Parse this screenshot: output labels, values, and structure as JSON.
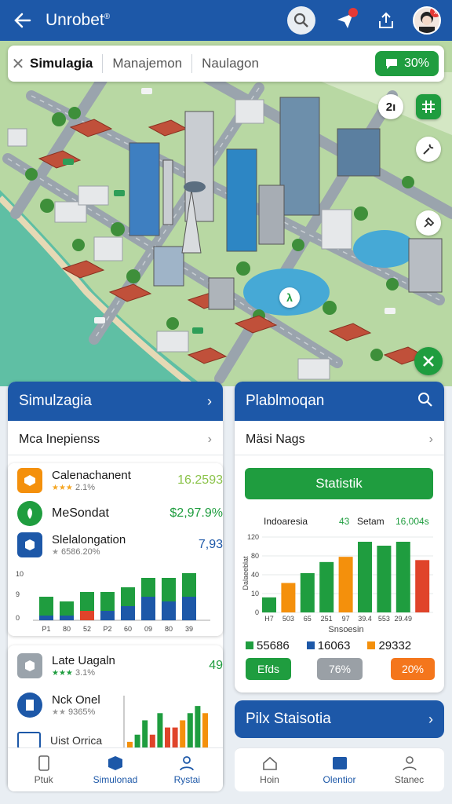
{
  "app": {
    "title": "Unrobet",
    "trademark": "®"
  },
  "header": {
    "avatar_badge": "x"
  },
  "tabs": {
    "items": [
      "Simulagia",
      "Manajemon",
      "Naulagon"
    ],
    "badge": "30%"
  },
  "map_labels": {
    "btn_a": "2ı",
    "lake_marker": "λ"
  },
  "left_panel": {
    "title": "Simulzagia",
    "row": "Mca Inepienss"
  },
  "right_panel": {
    "title": "Plablmoqan",
    "row": "Mäsi Nags",
    "button": "Statistik"
  },
  "list_a": [
    {
      "name": "Calenachanent",
      "sub": "2.1%",
      "value": "16.2593",
      "color": "#8bc34a",
      "stars": "★★★"
    },
    {
      "name": "MeSondat",
      "sub": "",
      "value": "$2,97.9%",
      "color": "#1f9d3f",
      "stars": ""
    },
    {
      "name": "Slelalongation",
      "sub": "6586.20%",
      "value": "7,93",
      "color": "#1d58a8",
      "stars": "★"
    }
  ],
  "list_b": [
    {
      "name": "Late Uagaln",
      "sub": "3.1%",
      "value": "49",
      "color": "#1f9d3f",
      "stars": "★★★"
    },
    {
      "name": "Nck Onel",
      "sub": "9365%",
      "value": "",
      "color": "#1d58a8",
      "stars": "★★"
    },
    {
      "name": "Uist Orrica",
      "sub": "",
      "value": "",
      "color": "#1d58a8",
      "stars": ""
    }
  ],
  "colors": {
    "blue": "#1d58a8",
    "green": "#1f9d3f",
    "orange": "#f4900c",
    "red": "#e0442a"
  },
  "chart_data": [
    {
      "type": "bar",
      "yticks": [
        "10",
        "9",
        "0"
      ],
      "categories": [
        "P1",
        "80",
        "52",
        "P2",
        "60",
        "09",
        "80",
        "39"
      ],
      "series": [
        {
          "values": [
            4,
            3,
            4,
            4,
            4,
            4,
            5,
            5
          ]
        },
        {
          "values": [
            1,
            1,
            2,
            2,
            3,
            5,
            4,
            5
          ]
        }
      ],
      "ylim": [
        0,
        10
      ]
    },
    {
      "type": "bar",
      "title": "Indoaresia",
      "header_values": [
        "43",
        "Setam",
        "16,004s"
      ],
      "yticks": [
        "120",
        "80",
        "40",
        "10",
        "0"
      ],
      "categories": [
        "H7",
        "503",
        "65",
        "251",
        "97",
        "39.4",
        "553",
        "29.49"
      ],
      "values": [
        23,
        45,
        60,
        77,
        85,
        108,
        102,
        108,
        80
      ],
      "colors": [
        "#1f9d3f",
        "#f4900c",
        "#1f9d3f",
        "#1f9d3f",
        "#f4900c",
        "#1f9d3f",
        "#1f9d3f",
        "#1f9d3f",
        "#e0442a"
      ],
      "ylabel": "Dalaeeblat",
      "xlabel": "Snsoesin",
      "ylim": [
        0,
        120
      ],
      "legend": [
        {
          "label": "55686",
          "color": "#1f9d3f"
        },
        {
          "label": "16063",
          "color": "#1d58a8"
        },
        {
          "label": "29332",
          "color": "#f4900c"
        }
      ]
    },
    {
      "type": "bar",
      "values": [
        1,
        2,
        4,
        2,
        5,
        3,
        3,
        4,
        5,
        6,
        5
      ],
      "colors": [
        "#f4900c",
        "#1f9d3f",
        "#1f9d3f",
        "#e0442a",
        "#1f9d3f",
        "#e0442a",
        "#e0442a",
        "#f4900c",
        "#1f9d3f",
        "#1f9d3f",
        "#f4900c"
      ],
      "ylim": [
        0,
        7
      ]
    }
  ],
  "pills": [
    "Efds",
    "76%",
    "20%"
  ],
  "banner": {
    "label": "Pilx Staisotia"
  },
  "nav_left": [
    {
      "label": "Ptuk"
    },
    {
      "label": "Simulonad"
    },
    {
      "label": "Rystai"
    }
  ],
  "nav_right": [
    {
      "label": "Hoin"
    },
    {
      "label": "Olentior"
    },
    {
      "label": "Stanec"
    }
  ]
}
